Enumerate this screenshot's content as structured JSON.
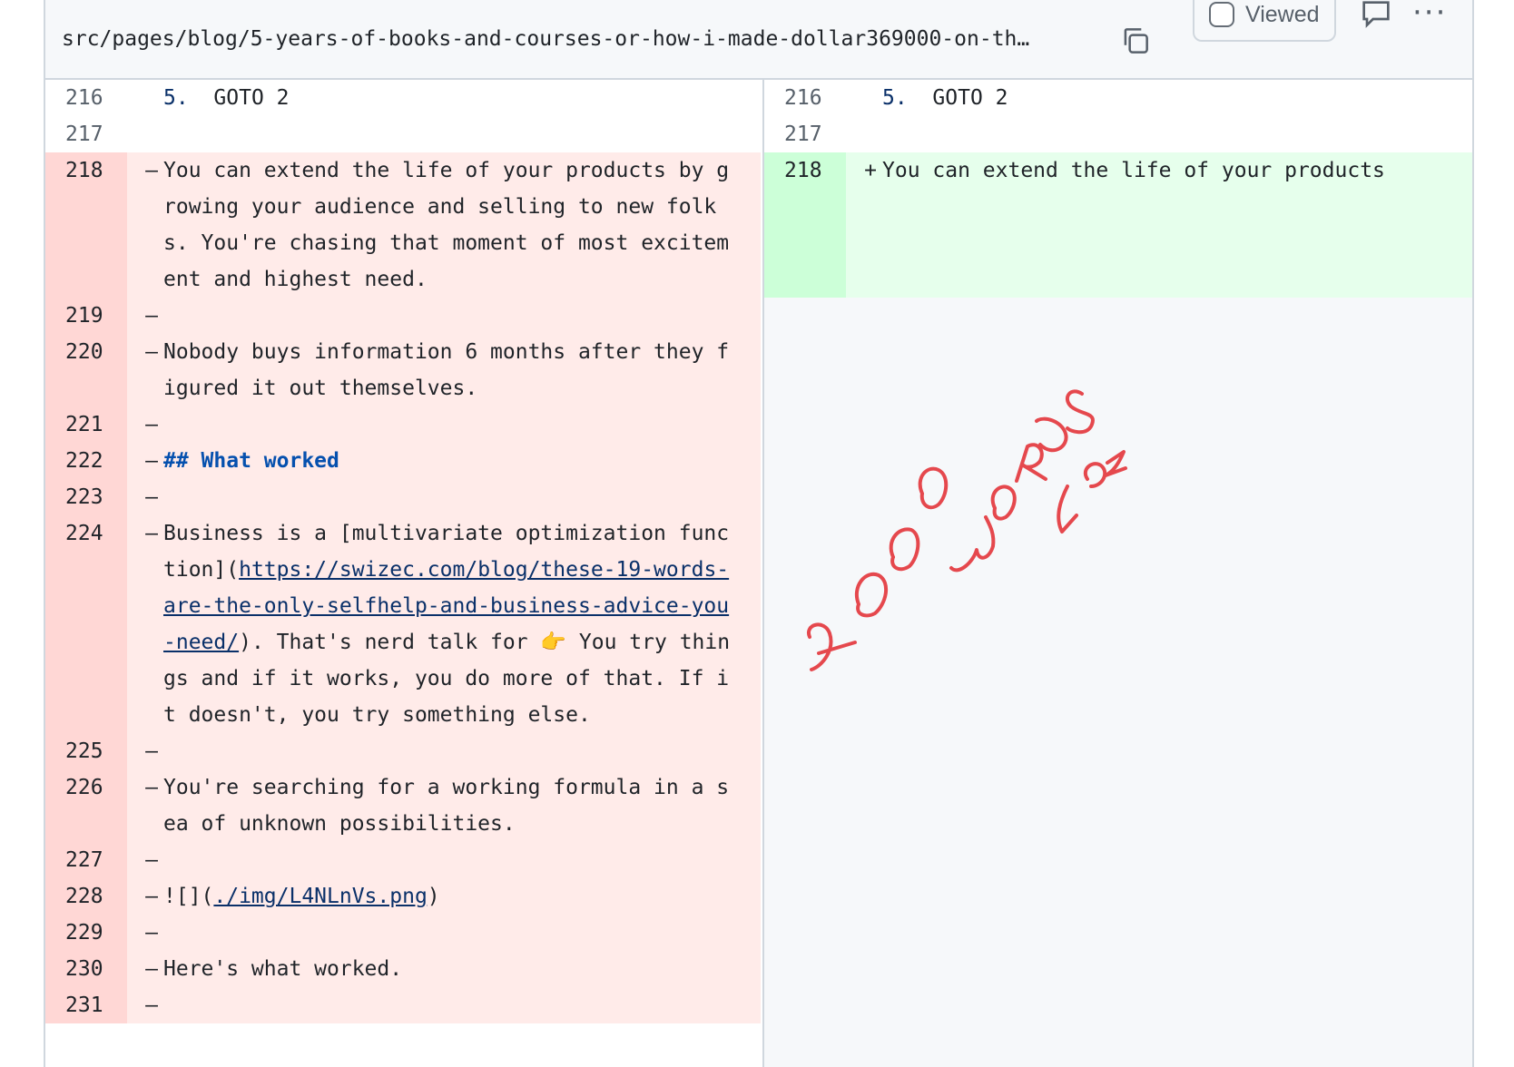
{
  "header": {
    "file_path": "src/pages/blog/5-years-of-books-and-courses-or-how-i-made-dollar369000-on-th…",
    "viewed_label": "Viewed",
    "more_label": "···"
  },
  "left": {
    "rows": [
      {
        "num": "216",
        "sign": "",
        "list": "5.",
        "text": "  GOTO 2"
      },
      {
        "num": "217",
        "sign": "",
        "text": ""
      },
      {
        "num": "218",
        "sign": "–",
        "text": "You can extend the life of your products by growing your audience and selling to new folks. You're chasing that moment of most excitement and highest need."
      },
      {
        "num": "219",
        "sign": "–",
        "text": ""
      },
      {
        "num": "220",
        "sign": "–",
        "text": "Nobody buys information 6 months after they figured it out themselves."
      },
      {
        "num": "221",
        "sign": "–",
        "text": ""
      },
      {
        "num": "222",
        "sign": "–",
        "heading": "## What worked"
      },
      {
        "num": "223",
        "sign": "–",
        "text": ""
      },
      {
        "num": "224",
        "sign": "–",
        "pre": "Business is a [multivariate optimization function](",
        "link": "https://swizec.com/blog/these-19-words-are-the-only-selfhelp-and-business-advice-you-need/",
        "post": "). That's nerd talk for 👉 You try things and if it works, you do more of that. If it doesn't, you try something else."
      },
      {
        "num": "225",
        "sign": "–",
        "text": ""
      },
      {
        "num": "226",
        "sign": "–",
        "text": "You're searching for a working formula in a sea of unknown possibilities."
      },
      {
        "num": "227",
        "sign": "–",
        "text": ""
      },
      {
        "num": "228",
        "sign": "–",
        "pre": "![](",
        "link": "./img/L4NLnVs.png",
        "post": ")"
      },
      {
        "num": "229",
        "sign": "–",
        "text": ""
      },
      {
        "num": "230",
        "sign": "–",
        "text": "Here's what worked."
      },
      {
        "num": "231",
        "sign": "–",
        "text": ""
      }
    ]
  },
  "right": {
    "rows": [
      {
        "num": "216",
        "sign": "",
        "list": "5.",
        "text": "  GOTO 2"
      },
      {
        "num": "217",
        "sign": "",
        "text": ""
      },
      {
        "num": "218",
        "sign": "+",
        "text": "You can extend the life of your products"
      }
    ]
  },
  "annotation": {
    "text": "2000 WORDS LOL",
    "color": "#e5484d"
  }
}
